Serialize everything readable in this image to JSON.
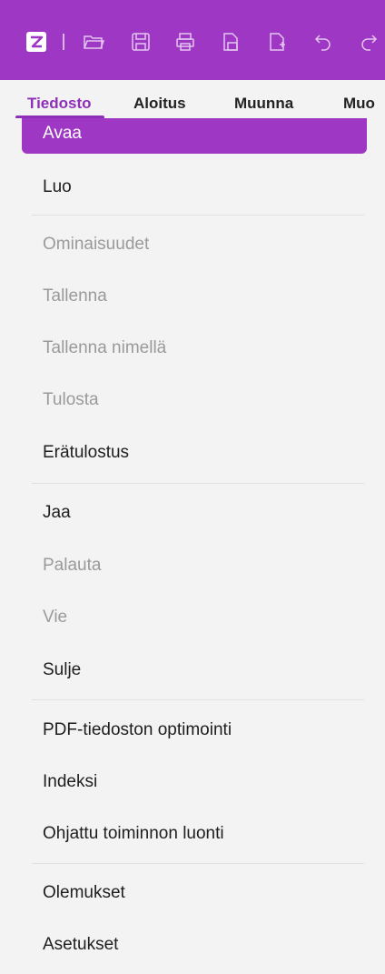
{
  "toolbar": {
    "icons": [
      "app-logo-icon",
      "open-folder-icon",
      "save-icon",
      "print-icon",
      "save-as-icon",
      "new-document-icon",
      "undo-icon",
      "redo-icon"
    ]
  },
  "tabs": [
    {
      "label": "Tiedosto",
      "active": true
    },
    {
      "label": "Aloitus",
      "active": false
    },
    {
      "label": "Muunna",
      "active": false
    },
    {
      "label": "Muo",
      "active": false
    }
  ],
  "menu": {
    "items": [
      {
        "label": "Avaa",
        "state": "selected"
      },
      {
        "label": "Luo",
        "state": "enabled"
      },
      {
        "label": "Ominaisuudet",
        "state": "disabled"
      },
      {
        "label": "Tallenna",
        "state": "disabled"
      },
      {
        "label": "Tallenna nimellä",
        "state": "disabled"
      },
      {
        "label": "Tulosta",
        "state": "disabled"
      },
      {
        "label": "Erätulostus",
        "state": "enabled"
      },
      {
        "label": "Jaa",
        "state": "enabled"
      },
      {
        "label": "Palauta",
        "state": "disabled"
      },
      {
        "label": "Vie",
        "state": "disabled"
      },
      {
        "label": "Sulje",
        "state": "enabled"
      },
      {
        "label": "PDF-tiedoston optimointi",
        "state": "enabled"
      },
      {
        "label": "Indeksi",
        "state": "enabled"
      },
      {
        "label": "Ohjattu toiminnon luonti",
        "state": "enabled"
      },
      {
        "label": "Olemukset",
        "state": "enabled"
      },
      {
        "label": "Asetukset",
        "state": "enabled"
      }
    ]
  },
  "colors": {
    "accent": "#9e37c4",
    "tab_active": "#8e2fb8",
    "disabled_text": "#9a9a9a",
    "text": "#1e1e1e"
  }
}
